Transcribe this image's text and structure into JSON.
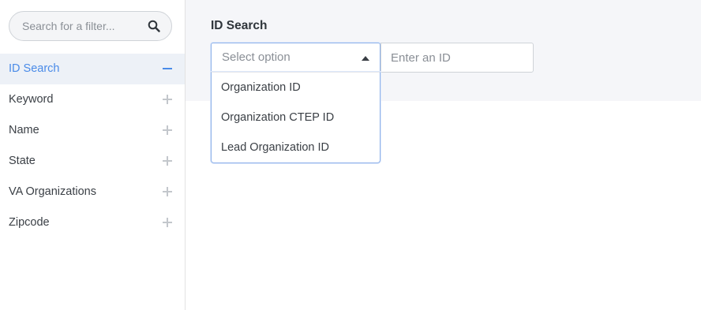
{
  "sidebar": {
    "search_placeholder": "Search for a filter...",
    "search_icon": "magnifier",
    "filters": [
      {
        "label": "ID Search",
        "active": true,
        "toggle": "minus"
      },
      {
        "label": "Keyword",
        "active": false,
        "toggle": "plus"
      },
      {
        "label": "Name",
        "active": false,
        "toggle": "plus"
      },
      {
        "label": "State",
        "active": false,
        "toggle": "plus"
      },
      {
        "label": "VA Organizations",
        "active": false,
        "toggle": "plus"
      },
      {
        "label": "Zipcode",
        "active": false,
        "toggle": "plus"
      }
    ]
  },
  "main": {
    "panel_title": "ID Search",
    "select_placeholder": "Select option",
    "id_placeholder": "Enter an ID",
    "options": [
      "Organization ID",
      "Organization CTEP ID",
      "Lead Organization ID"
    ]
  },
  "colors": {
    "accent": "#4a8be8",
    "active_bg": "#edf1f7",
    "panel_bg": "#f5f6f9",
    "focus_border": "#8fb2ea"
  }
}
